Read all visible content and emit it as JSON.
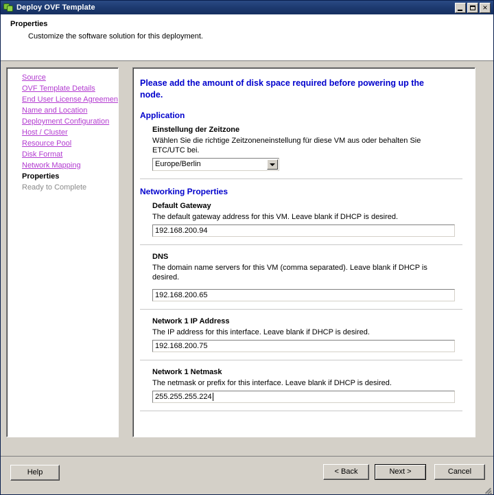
{
  "window": {
    "title": "Deploy OVF Template",
    "icon": "vmware-ovf-icon",
    "minimize_label": "Minimize",
    "maximize_label": "Maximize",
    "close_label": "Close",
    "accent_title_bg": "#1d3a70",
    "accent_link": "#b23ad0",
    "accent_heading": "#0000cc"
  },
  "header": {
    "title": "Properties",
    "subtitle": "Customize the software solution for this deployment."
  },
  "sidebar": {
    "items": [
      {
        "label": "Source",
        "state": "link"
      },
      {
        "label": "OVF Template Details",
        "state": "link"
      },
      {
        "label": "End User License Agreement",
        "state": "link"
      },
      {
        "label": "Name and Location",
        "state": "link"
      },
      {
        "label": "Deployment Configuration",
        "state": "link"
      },
      {
        "label": "Host / Cluster",
        "state": "link"
      },
      {
        "label": "Resource Pool",
        "state": "link"
      },
      {
        "label": "Disk Format",
        "state": "link"
      },
      {
        "label": "Network Mapping",
        "state": "link"
      },
      {
        "label": "Properties",
        "state": "current"
      },
      {
        "label": "Ready to Complete",
        "state": "disabled"
      }
    ]
  },
  "content": {
    "notice": "Please add the amount of disk space required before powering up the node.",
    "sections": [
      {
        "heading": "Application",
        "fields": [
          {
            "label": "Einstellung der Zeitzone",
            "description": "Wählen Sie die richtige Zeitzoneneinstellung für diese VM aus oder behalten Sie ETC/UTC bei.",
            "control": "select",
            "value": "Europe/Berlin"
          }
        ]
      },
      {
        "heading": "Networking Properties",
        "fields": [
          {
            "label": "Default Gateway",
            "description": "The default gateway address for this VM. Leave blank if DHCP is desired.",
            "control": "text",
            "value": "192.168.200.94"
          },
          {
            "label": "DNS",
            "description": "The domain name servers for this VM (comma separated). Leave blank if DHCP is desired.",
            "control": "text",
            "value": "192.168.200.65"
          },
          {
            "label": "Network 1 IP Address",
            "description": "The IP address for this interface. Leave blank if DHCP is desired.",
            "control": "text",
            "value": "192.168.200.75"
          },
          {
            "label": "Network 1 Netmask",
            "description": "The netmask or prefix for this interface. Leave blank if DHCP is desired.",
            "control": "text",
            "value": "255.255.255.224",
            "focused": true
          }
        ]
      }
    ]
  },
  "footer": {
    "help_label": "Help",
    "back_label": "< Back",
    "next_label": "Next >",
    "cancel_label": "Cancel",
    "resize_grip": "resize-grip-icon"
  }
}
